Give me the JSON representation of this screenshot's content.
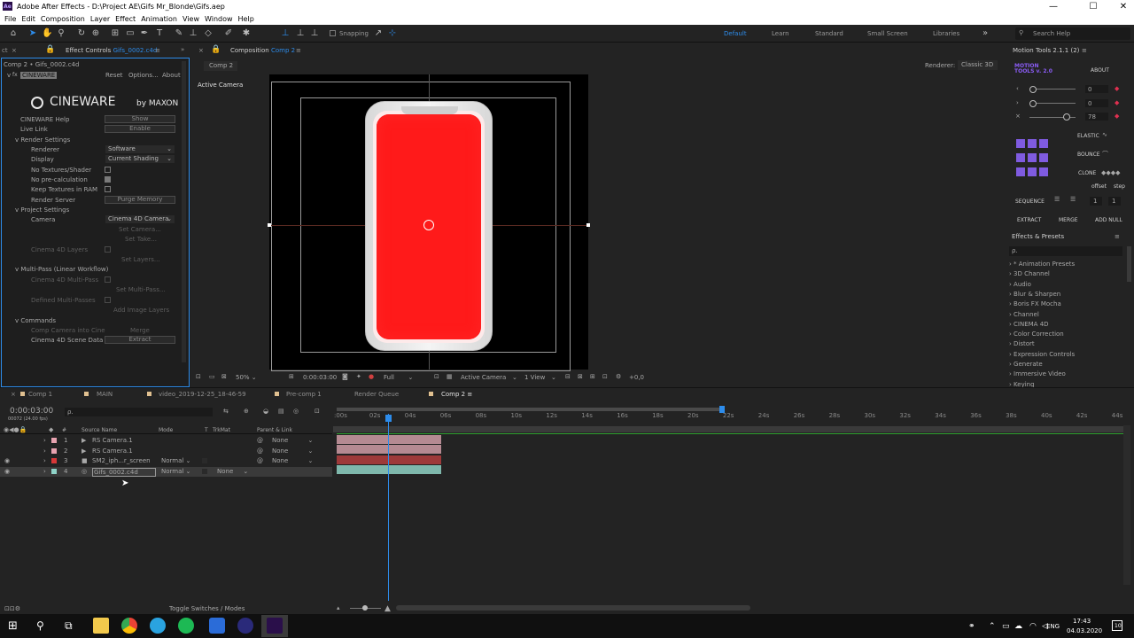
{
  "window": {
    "title": "Adobe After Effects - D:\\Project AE\\Gifs Mr_Blonde\\Gifs.aep",
    "min": "—",
    "max": "☐",
    "close": "✕"
  },
  "menu": [
    "File",
    "Edit",
    "Composition",
    "Layer",
    "Effect",
    "Animation",
    "View",
    "Window",
    "Help"
  ],
  "toolbar": {
    "snapping": "Snapping",
    "workspaces": [
      "Default",
      "Learn",
      "Standard",
      "Small Screen",
      "Libraries"
    ],
    "search_help": "Search Help"
  },
  "effect_controls": {
    "tab_prefix": "Effect Controls",
    "tab_layer": "Gifs_0002.c4d",
    "breadcrumb": "Comp 2 • Gifs_0002.c4d",
    "effect_name": "CINEWARE",
    "reset": "Reset",
    "options": "Options...",
    "about": "About",
    "logo_main": "CINEWARE",
    "logo_by": "by MAXON",
    "rows": {
      "help_label": "CINEWARE Help",
      "help_btn": "Show",
      "livelink_label": "Live Link",
      "livelink_btn": "Enable",
      "render_settings": "Render Settings",
      "renderer_label": "Renderer",
      "renderer_val": "Software",
      "display_label": "Display",
      "display_val": "Current Shading",
      "no_textures": "No Textures/Shader",
      "no_precalc": "No pre-calculation",
      "keep_textures": "Keep Textures in RAM",
      "render_server": "Render Server",
      "purge": "Purge Memory",
      "project_settings": "Project Settings",
      "camera_label": "Camera",
      "camera_val": "Cinema 4D Camera",
      "set_camera": "Set Camera...",
      "set_take": "Set Take...",
      "c4d_layers": "Cinema 4D Layers",
      "set_layers": "Set Layers...",
      "multipass": "Multi-Pass (Linear Workflow)",
      "c4d_multipass": "Cinema 4D Multi-Pass",
      "set_multipass": "Set Multi-Pass...",
      "defined_multipass": "Defined Multi-Passes",
      "add_image_layers": "Add Image Layers",
      "commands": "Commands",
      "comp_camera": "Comp Camera into Cine",
      "merge": "Merge",
      "scene_data": "Cinema 4D Scene Data",
      "extract": "Extract"
    }
  },
  "composition": {
    "tab_prefix": "Composition",
    "tab_name": "Comp 2",
    "sub_tab": "Comp 2",
    "renderer_label": "Renderer:",
    "renderer_val": "Classic 3D",
    "view_label": "Active Camera",
    "footer": {
      "zoom": "50%",
      "time": "0:00:03:00",
      "res": "Full",
      "camera": "Active Camera",
      "views": "1 View",
      "exposure": "+0,0"
    }
  },
  "motion_tools": {
    "title": "Motion Tools 2.1.1 (2)",
    "logo": "MOTION\nTOOLS v. 2.0",
    "about": "ABOUT",
    "values": [
      "0",
      "0",
      "78"
    ],
    "elastic": "ELASTIC",
    "bounce": "BOUNCE",
    "clone": "CLONE",
    "offset": "offset",
    "step": "step",
    "sequence": "SEQUENCE",
    "seq_vals": [
      "1",
      "1"
    ],
    "extract": "EXTRACT",
    "merge": "MERGE",
    "add_null": "ADD NULL"
  },
  "effects_presets": {
    "title": "Effects & Presets",
    "search_placeholder": "ρ.",
    "items": [
      "* Animation Presets",
      "3D Channel",
      "Audio",
      "Blur & Sharpen",
      "Boris FX Mocha",
      "Channel",
      "CINEMA 4D",
      "Color Correction",
      "Distort",
      "Expression Controls",
      "Generate",
      "Immersive Video",
      "Keying"
    ]
  },
  "timeline": {
    "tabs": [
      "Comp 1",
      "MAIN",
      "video_2019-12-25_18-46-59",
      "Pre-comp 1",
      "Render Queue",
      "Comp 2"
    ],
    "active_tab": "Comp 2",
    "timecode": "0:00:03:00",
    "frames": "00072 (24.00 fps)",
    "columns": {
      "num": "#",
      "source": "Source Name",
      "mode": "Mode",
      "t": "T",
      "trkmat": "TrkMat",
      "parent": "Parent & Link"
    },
    "layers": [
      {
        "num": "1",
        "name": "RS Camera.1",
        "mode": "",
        "trk": "",
        "parent": "None",
        "color": "#e8a3b0"
      },
      {
        "num": "2",
        "name": "RS Camera.1",
        "mode": "",
        "trk": "",
        "parent": "None",
        "color": "#e8a3b0"
      },
      {
        "num": "3",
        "name": "SM2_iph...r_screen",
        "mode": "Normal",
        "trk": "",
        "parent": "None",
        "color": "#d63838"
      },
      {
        "num": "4",
        "name": "Gifs_0002.c4d",
        "mode": "Normal",
        "trk": "None",
        "parent": "",
        "color": "#8fd3c8"
      }
    ],
    "ruler": [
      ":00s",
      "02s",
      "04s",
      "06s",
      "08s",
      "10s",
      "12s",
      "14s",
      "16s",
      "18s",
      "20s",
      "22s",
      "24s",
      "26s",
      "28s",
      "30s",
      "32s",
      "34s",
      "36s",
      "38s",
      "40s",
      "42s",
      "44s"
    ],
    "toggle": "Toggle Switches / Modes"
  },
  "taskbar": {
    "lang": "ENG",
    "time": "17:43",
    "date": "04.03.2020",
    "notif": "10"
  }
}
